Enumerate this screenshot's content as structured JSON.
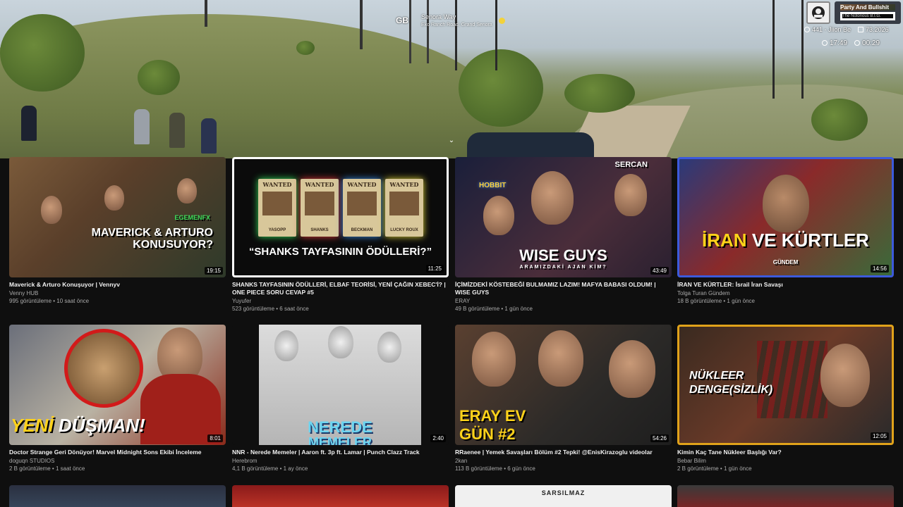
{
  "overlay": {
    "region": "GB",
    "location": "Senora Way",
    "location_sub": "Eko Ranch Road, Grand Senora",
    "hud_title": "Party And Bullshit",
    "hud_sub": "The Notorious B.I.G.",
    "hud_row1": [
      "441 - Jiion Be",
      "73.2026"
    ],
    "hud_row2": [
      "17:49",
      "00:29"
    ]
  },
  "chevron": "⌄",
  "videos": [
    {
      "thumb_caption": "MAVERICK & ARTURO KONUSUYOR?",
      "thumb_tag": "EGEMENFX",
      "duration": "19:15",
      "title": "Maverick & Arturo Konuşuyor | Vennyv",
      "channel": "Venny HUB",
      "stats": "995 görüntüleme • 10 saat önce"
    },
    {
      "thumb_caption": "“SHANKS TAYFASININ ÖDÜLLERİ?”",
      "posters": [
        "YASOPP",
        "SHANKS",
        "BECKMAN",
        "LUCKY ROUX"
      ],
      "poster_label": "WANTED",
      "duration": "11:25",
      "title": "SHANKS TAYFASININ ÖDÜLLERİ, ELBAF TEORİSİ, YENİ ÇAĞIN XEBEC'İ? | ONE PIECE SORU CEVAP #5",
      "channel": "Yuyufer",
      "stats": "523 görüntüleme • 6 saat önce"
    },
    {
      "thumb_caption": "WISE GUYS",
      "thumb_sub": "ARAMIZDAKİ AJAN KİM?",
      "thumb_tag": "SERCAN",
      "thumb_neon": "HOBBIT",
      "duration": "43:49",
      "title": "İÇİMİZDEKİ KÖSTEBEĞİ BULMAMIZ LAZIM! MAFYA BABASI OLDUM! | WISE GUYS",
      "channel": "ERAY",
      "stats": "49 B görüntüleme • 1 gün önce"
    },
    {
      "thumb_caption_a": "İRAN",
      "thumb_caption_b": "VE KÜRTLER",
      "thumb_sub": "GÜNDEM",
      "duration": "14:56",
      "title": "İRAN VE KÜRTLER: İsrail İran Savaşı",
      "channel": "Tolga Turan Gündem",
      "stats": "18 B görüntüleme • 1 gün önce"
    },
    {
      "thumb_caption_a": "YENİ",
      "thumb_caption_b": "DÜŞMAN!",
      "duration": "8:01",
      "title": "Doctor Strange Geri Dönüyor! Marvel Midnight Sons Ekibi İnceleme",
      "channel": "doguqn STUDIOS",
      "stats": "2 B görüntüleme • 1 saat önce"
    },
    {
      "thumb_caption": "NEREDE",
      "thumb_caption2": "MEMELER",
      "duration": "2:40",
      "title": "NNR - Nerede Memeler | Aaron ft. 3p ft. Lamar | Punch Clazz Track",
      "channel": "Herebrom",
      "stats": "4,1 B görüntüleme • 1 ay önce"
    },
    {
      "thumb_caption": "ERAY EV",
      "thumb_caption2": "GÜN #2",
      "duration": "54:26",
      "title": "RRaenee | Yemek Savaşları Bölüm #2 Tepki! @EnisKirazoglu videolar",
      "channel": "2kan",
      "stats": "113 B görüntüleme • 6 gün önce"
    },
    {
      "thumb_caption": "NÜKLEER",
      "thumb_caption2": "DENGE(SİZLİK)",
      "duration": "12:05",
      "title": "Kimin Kaç Tane Nükleer Başlığı Var?",
      "channel": "Bebar Bilim",
      "stats": "2 B görüntüleme • 1 gün önce"
    }
  ],
  "partial_row": {
    "brand_label": "SARSILMAZ"
  }
}
